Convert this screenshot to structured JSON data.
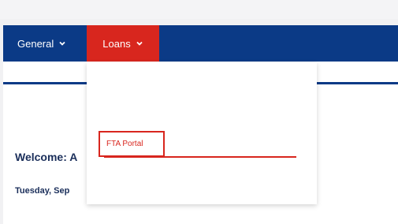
{
  "nav": {
    "items": [
      {
        "label": "General",
        "icon": "chevron-down-icon"
      },
      {
        "label": "Loans",
        "icon": "chevron-down-icon"
      }
    ]
  },
  "dropdown": {
    "items": [
      {
        "label": "FTA Portal"
      }
    ]
  },
  "page": {
    "welcome": "Welcome: A",
    "date": "Tuesday, Sep"
  },
  "colors": {
    "nav_bg": "#0b3a86",
    "active_bg": "#d8261e",
    "link_red": "#d8261e"
  }
}
